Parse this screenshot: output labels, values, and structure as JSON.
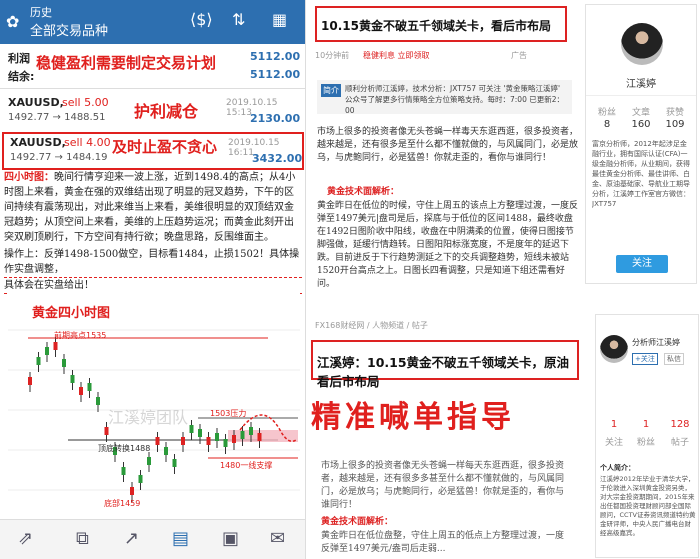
{
  "left_app": {
    "header": {
      "line1": "历史",
      "line2": "全部交易品种"
    },
    "account": {
      "profit_label": "利润",
      "profit_value": "5112.00",
      "balance_label": "结余:",
      "balance_value": "5112.00"
    },
    "overlay_texts": {
      "plan": "稳健盈利需要制定交易计划",
      "protect": "护利减仓",
      "takeprofit": "及时止盈不贪心"
    },
    "positions": [
      {
        "symbol": "XAUUSD,",
        "side": "sell 5.00",
        "prices": "1492.77 → 1488.51",
        "time": "2019.10.15 15:13",
        "pl": "2130.00"
      },
      {
        "symbol": "XAUUSD,",
        "side": "sell 4.00",
        "prices": "1492.77 → 1484.19",
        "time": "2019.10.15 16:11",
        "pl": "3432.00"
      }
    ],
    "analysis": {
      "head": "四小时图：",
      "body": "晚间行情亨迎来一波上涨，近到1498.4的高点；从4小时图上来看，黄金在强的双维结出现了明显的冠叉趋势，下午的区间持续有震荡现出，对此来维当上来看，美维很明显的双顶结双金冠趋势；从顶空间上来看，美维的上压趋势运况；而黄金此刻开出突双刷顶刷行，下方空间有持行欲；晚盘思路，反围维面主。",
      "op_line": "操作上：反弹1498-1500做空，目标看1484，止损1502！具体操作实盘调整，",
      "note": "具体会在实盘给出！"
    },
    "chart": {
      "title": "黄金四小时图",
      "labels": {
        "high": "前期高点1535",
        "support": "顶底转换1488",
        "low": "底部1459",
        "r1": "1503压力",
        "s1": "1480一线支撑"
      },
      "watermark": "江溪婷团队"
    }
  },
  "article_top": {
    "title": "10.15黄金不破五千领域关卡，看后市布局",
    "meta": "10分钟前",
    "red_tag": "稳健利息 立即领取",
    "ad": "广告",
    "intro_tag": "简介",
    "intro_text": "顺利分析师江溪婷，技术分析：JXT757 可关注 '黄金策略江溪婷' 公众号了解更多行情策略全方位策略支持。每时：7:00 已更新2：00",
    "body1": "市场上很多的投资者像无头苍蝇一样毒天东逛西逛，很多投资者，越来越是，还有很多是至什么都不懂就做的，与风属同门，必是放乌，与虎鲍同行，必是猛兽！你就走歪的，看你与谁同行！",
    "red_head": "黄金技术面解析：",
    "body2": "黄金昨日在低位的时候，守住上周五的该点上方整理过渡，一度反弹至1497美元|盘司是后，探底与于低位的区间1488，最终收盘在1492日图阶收中阳线，收盘在中阴满柔的位置，使得日图接节脚强做，延缓行情趋转。日图阳阳标涨宽度，不是度年的延迟下跌。目前进反于下行趋势测延之下的交兵调整趋势，短线未被站1520开台高点之上。日图长四看调整，只是知道下组还需看好问。"
  },
  "middle": {
    "breadcrumb": "FX168财经网 / 人物频道 / 帖子",
    "title": "江溪婷：10.15黄金不破五千领域关卡，原油看后市布局",
    "overlay_big": "精准喊单指导",
    "body3": "市场上很多的投资者像无头苍蝇一样每天东逛西逛，很多投资者，越来越是，还有很多多甚至什么都不懂就做的，与风属同门，必是放乌；与虎鲍同行，必是猛兽！你就是歪的，看你与谁同行！",
    "red_head2": "黄金技术面解析：",
    "body4": "黄金昨日在低位盘整，守住上周五的低点上方整理过渡，一度反弹至1497美元/盎司后走弱..."
  },
  "profile_top": {
    "name": "江溪婷",
    "stats": [
      {
        "label": "粉丝",
        "value": "8"
      },
      {
        "label": "文章",
        "value": "160"
      },
      {
        "label": "获赞",
        "value": "109"
      }
    ],
    "bio": "富京分析师，2012年起涉足金融行业，拥有国际认证(CFA)一级金融分析师，从业期间，获得最佳黄金分析师、最佳讲师、白金、原油基础家、导航业工期导分析，江溪婷工作室官方微信：JXT757",
    "follow": "关注"
  },
  "profile_bottom": {
    "name": "分析师江溪婷",
    "follow_btn": "+关注",
    "msg_btn": "私信",
    "stats": [
      {
        "label": "关注",
        "value": "1"
      },
      {
        "label": "粉丝",
        "value": "1"
      },
      {
        "label": "帖子",
        "value": "128"
      }
    ],
    "bio_head": "个人简介：",
    "bio": "江溪婷2012年毕业于清华大学，于伦敦进入深圳黄金投资另类，对大宗金投资期期间，2015年来出任都国投资理财顾问部全国际顾问，CCTV证券资讯频道特约黄金研评师，中央人民广播电台财经高级嘉宾。"
  },
  "colors": {
    "brand_blue": "#2d6fb0",
    "accent_red": "#e0201e",
    "follow_blue": "#2f9be0"
  }
}
